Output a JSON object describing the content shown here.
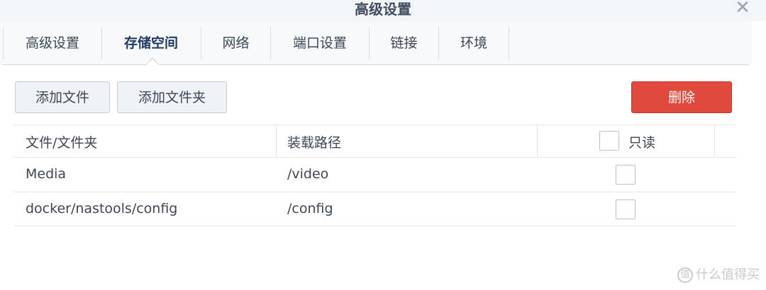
{
  "window": {
    "title": "高级设置",
    "close_icon": "close-icon"
  },
  "tabs": [
    {
      "label": "高级设置",
      "active": false
    },
    {
      "label": "存储空间",
      "active": true
    },
    {
      "label": "网络",
      "active": false
    },
    {
      "label": "端口设置",
      "active": false
    },
    {
      "label": "链接",
      "active": false
    },
    {
      "label": "环境",
      "active": false
    }
  ],
  "toolbar": {
    "add_file": "添加文件",
    "add_folder": "添加文件夹",
    "delete": "删除",
    "delete_color": "#df4a3d"
  },
  "table": {
    "columns": [
      "文件/文件夹",
      "装载路径",
      "只读"
    ],
    "header_readonly_checked": false,
    "rows": [
      {
        "path": "Media",
        "mount": "/video",
        "readonly": false
      },
      {
        "path": "docker/nastools/config",
        "mount": "/config",
        "readonly": false
      }
    ]
  },
  "watermark": {
    "text": "什么值得买",
    "icon": "值"
  }
}
